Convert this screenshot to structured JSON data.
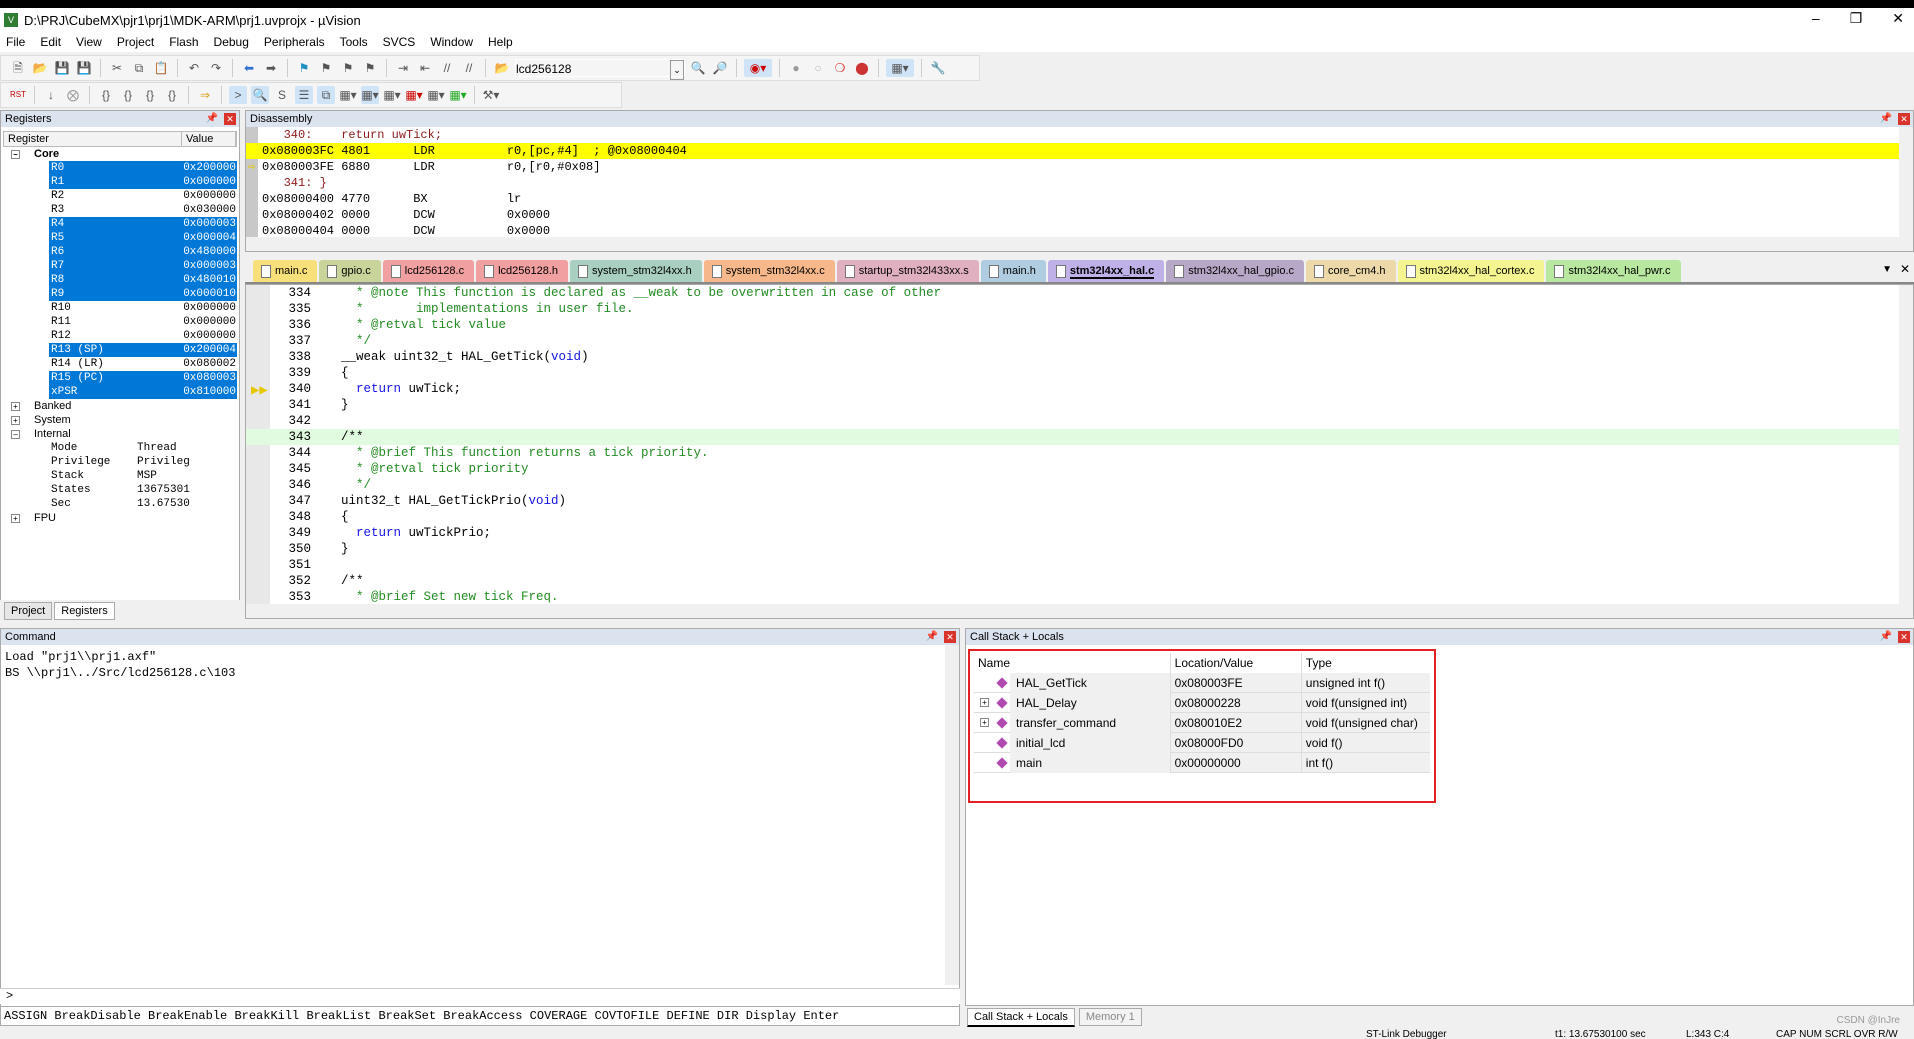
{
  "window": {
    "title": "D:\\PRJ\\CubeMX\\pjr1\\prj1\\MDK-ARM\\prj1.uvprojx - µVision",
    "logo": "V5"
  },
  "menu": [
    "File",
    "Edit",
    "View",
    "Project",
    "Flash",
    "Debug",
    "Peripherals",
    "Tools",
    "SVCS",
    "Window",
    "Help"
  ],
  "toolbar": {
    "target": "lcd256128"
  },
  "registers": {
    "title": "Registers",
    "col_register": "Register",
    "col_value": "Value",
    "core_label": "Core",
    "core": [
      {
        "n": "R0",
        "v": "0x200000",
        "sel": true
      },
      {
        "n": "R1",
        "v": "0x000000",
        "sel": true
      },
      {
        "n": "R2",
        "v": "0x000000",
        "sel": false
      },
      {
        "n": "R3",
        "v": "0x030000",
        "sel": false
      },
      {
        "n": "R4",
        "v": "0x000003",
        "sel": true
      },
      {
        "n": "R5",
        "v": "0x000004",
        "sel": true
      },
      {
        "n": "R6",
        "v": "0x480000",
        "sel": true
      },
      {
        "n": "R7",
        "v": "0x000003",
        "sel": true
      },
      {
        "n": "R8",
        "v": "0x480010",
        "sel": true
      },
      {
        "n": "R9",
        "v": "0x000010",
        "sel": true
      },
      {
        "n": "R10",
        "v": "0x000000",
        "sel": false
      },
      {
        "n": "R11",
        "v": "0x000000",
        "sel": false
      },
      {
        "n": "R12",
        "v": "0x000000",
        "sel": false
      },
      {
        "n": "R13 (SP)",
        "v": "0x200004",
        "sel": true
      },
      {
        "n": "R14 (LR)",
        "v": "0x080002",
        "sel": false
      },
      {
        "n": "R15 (PC)",
        "v": "0x080003",
        "sel": true
      },
      {
        "n": "xPSR",
        "v": "0x810000",
        "sel": true
      }
    ],
    "banked": "Banked",
    "system": "System",
    "internal": "Internal",
    "internal_items": [
      {
        "k": "Mode",
        "v": "Thread"
      },
      {
        "k": "Privilege",
        "v": "Privileg"
      },
      {
        "k": "Stack",
        "v": "MSP"
      },
      {
        "k": "States",
        "v": "13675301"
      },
      {
        "k": "Sec",
        "v": "13.67530"
      }
    ],
    "fpu": "FPU"
  },
  "left_tabs": [
    "Project",
    "Registers"
  ],
  "disassembly": {
    "title": "Disassembly",
    "lines": [
      {
        "t": "   340:    return uwTick;",
        "type": "src"
      },
      {
        "t": "0x080003FC 4801      LDR          r0,[pc,#4]  ; @0x08000404",
        "type": "hl"
      },
      {
        "t": "0x080003FE 6880      LDR          r0,[r0,#0x08]",
        "type": "arrow"
      },
      {
        "t": "   341: }",
        "type": "src"
      },
      {
        "t": "0x08000400 4770      BX           lr",
        "type": ""
      },
      {
        "t": "0x08000402 0000      DCW          0x0000",
        "type": ""
      },
      {
        "t": "0x08000404 0000      DCW          0x0000",
        "type": ""
      }
    ]
  },
  "file_tabs": [
    {
      "name": "main.c",
      "color": "#f7e07a"
    },
    {
      "name": "gpio.c",
      "color": "#c8d49a"
    },
    {
      "name": "lcd256128.c",
      "color": "#f0a0a0"
    },
    {
      "name": "lcd256128.h",
      "color": "#f0a0a0"
    },
    {
      "name": "system_stm32l4xx.h",
      "color": "#a8cfc0"
    },
    {
      "name": "system_stm32l4xx.c",
      "color": "#f6b88a"
    },
    {
      "name": "startup_stm32l433xx.s",
      "color": "#e0b0c0"
    },
    {
      "name": "main.h",
      "color": "#b0cce0"
    },
    {
      "name": "stm32l4xx_hal.c",
      "color": "#c0b0e8",
      "active": true
    },
    {
      "name": "stm32l4xx_hal_gpio.c",
      "color": "#b8a8c8"
    },
    {
      "name": "core_cm4.h",
      "color": "#ecd8a8"
    },
    {
      "name": "stm32l4xx_hal_cortex.c",
      "color": "#f4f490"
    },
    {
      "name": "stm32l4xx_hal_pwr.c",
      "color": "#b8e8a0"
    }
  ],
  "editor": {
    "lines": [
      {
        "n": "334",
        "html": "<span class='cm'>  * @note This function is declared as __weak to be overwritten in case of other</span>"
      },
      {
        "n": "335",
        "html": "<span class='cm'>  *       implementations in user file.</span>"
      },
      {
        "n": "336",
        "html": "<span class='cm'>  * @retval tick value</span>"
      },
      {
        "n": "337",
        "html": "<span class='cm'>  */</span>"
      },
      {
        "n": "338",
        "html": "__weak uint32_t HAL_GetTick(<span class='kw'>void</span>)"
      },
      {
        "n": "339",
        "html": "{"
      },
      {
        "n": "340",
        "html": "  <span class='kw'>return</span> uwTick;"
      },
      {
        "n": "341",
        "html": "}"
      },
      {
        "n": "342",
        "html": ""
      },
      {
        "n": "343",
        "html": "/**",
        "cur": true
      },
      {
        "n": "344",
        "html": "<span class='cm'>  * @brief This function returns a tick priority.</span>"
      },
      {
        "n": "345",
        "html": "<span class='cm'>  * @retval tick priority</span>"
      },
      {
        "n": "346",
        "html": "<span class='cm'>  */</span>"
      },
      {
        "n": "347",
        "html": "uint32_t HAL_GetTickPrio(<span class='kw'>void</span>)"
      },
      {
        "n": "348",
        "html": "{"
      },
      {
        "n": "349",
        "html": "  <span class='kw'>return</span> uwTickPrio;"
      },
      {
        "n": "350",
        "html": "}"
      },
      {
        "n": "351",
        "html": ""
      },
      {
        "n": "352",
        "html": "/**"
      },
      {
        "n": "353",
        "html": "<span class='cm'>  * @brief Set new tick Freq.</span>"
      }
    ]
  },
  "command": {
    "title": "Command",
    "lines": "Load \"prj1\\\\prj1.axf\"\nBS \\\\prj1\\../Src/lcd256128.c\\103",
    "prompt": ">",
    "help": "ASSIGN BreakDisable BreakEnable BreakKill BreakList BreakSet BreakAccess COVERAGE COVTOFILE DEFINE DIR Display Enter"
  },
  "callstack": {
    "title": "Call Stack + Locals",
    "cols": [
      "Name",
      "Location/Value",
      "Type"
    ],
    "rows": [
      {
        "name": "HAL_GetTick",
        "loc": "0x080003FE",
        "type": "unsigned int f()",
        "exp": false
      },
      {
        "name": "HAL_Delay",
        "loc": "0x08000228",
        "type": "void f(unsigned int)",
        "exp": true
      },
      {
        "name": "transfer_command",
        "loc": "0x080010E2",
        "type": "void f(unsigned char)",
        "exp": true
      },
      {
        "name": "initial_lcd",
        "loc": "0x08000FD0",
        "type": "void f()",
        "exp": false
      },
      {
        "name": "main",
        "loc": "0x00000000",
        "type": "int f()",
        "exp": false
      }
    ]
  },
  "right_tabs": [
    "Call Stack + Locals",
    "Memory 1"
  ],
  "status": {
    "debugger": "ST-Link Debugger",
    "time": "t1: 13.67530100 sec",
    "pos": "L:343 C:4",
    "flags": "CAP  NUM  SCRL  OVR  R/W"
  },
  "watermark": "CSDN @InJre"
}
